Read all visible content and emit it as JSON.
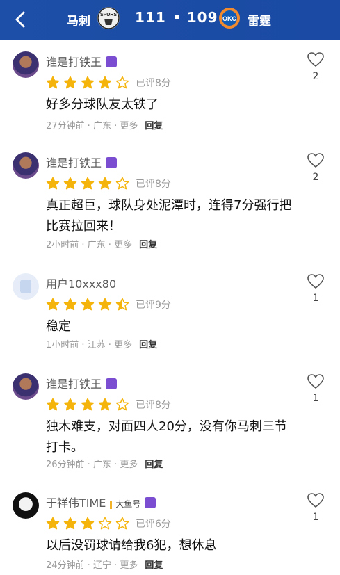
{
  "header": {
    "team_left": "马刺",
    "team_right": "雷霆",
    "score_left": "111",
    "score_right": "109",
    "logo_left_text": "SPURS",
    "logo_right_text": "OKC"
  },
  "colors": {
    "header_bg": "#1d4fa8",
    "star": "#f5b40b",
    "badge": "#7b4ed1"
  },
  "comments": [
    {
      "name": "谁是打铁王",
      "rated": "已评8分",
      "stars": 4,
      "text": "好多分球队友太铁了",
      "meta": "27分钟前 · 广东 · 更多",
      "reply": "回复",
      "likes": "2"
    },
    {
      "name": "谁是打铁王",
      "rated": "已评8分",
      "stars": 4,
      "text": "真正超巨，球队身处泥潭时，连得7分强行把比赛拉回来！",
      "meta": "2小时前 · 广东 · 更多",
      "reply": "回复",
      "likes": "2"
    },
    {
      "name": "用户10xxx80",
      "rated": "已评9分",
      "stars": 4.5,
      "text": "稳定",
      "meta": "1小时前 · 江苏 · 更多",
      "reply": "回复",
      "likes": "1"
    },
    {
      "name": "谁是打铁王",
      "rated": "已评8分",
      "stars": 4,
      "text": "独木难支，对面四人20分，没有你马刺三节打卡。",
      "meta": "26分钟前 · 广东 · 更多",
      "reply": "回复",
      "likes": "1"
    },
    {
      "name": "于祥伟TIME",
      "tag": "大鱼号",
      "rated": "已评6分",
      "stars": 3,
      "text": "以后没罚球请给我6犯，想休息",
      "meta": "24分钟前 · 辽宁 · 更多",
      "reply": "回复",
      "likes": "1"
    }
  ]
}
